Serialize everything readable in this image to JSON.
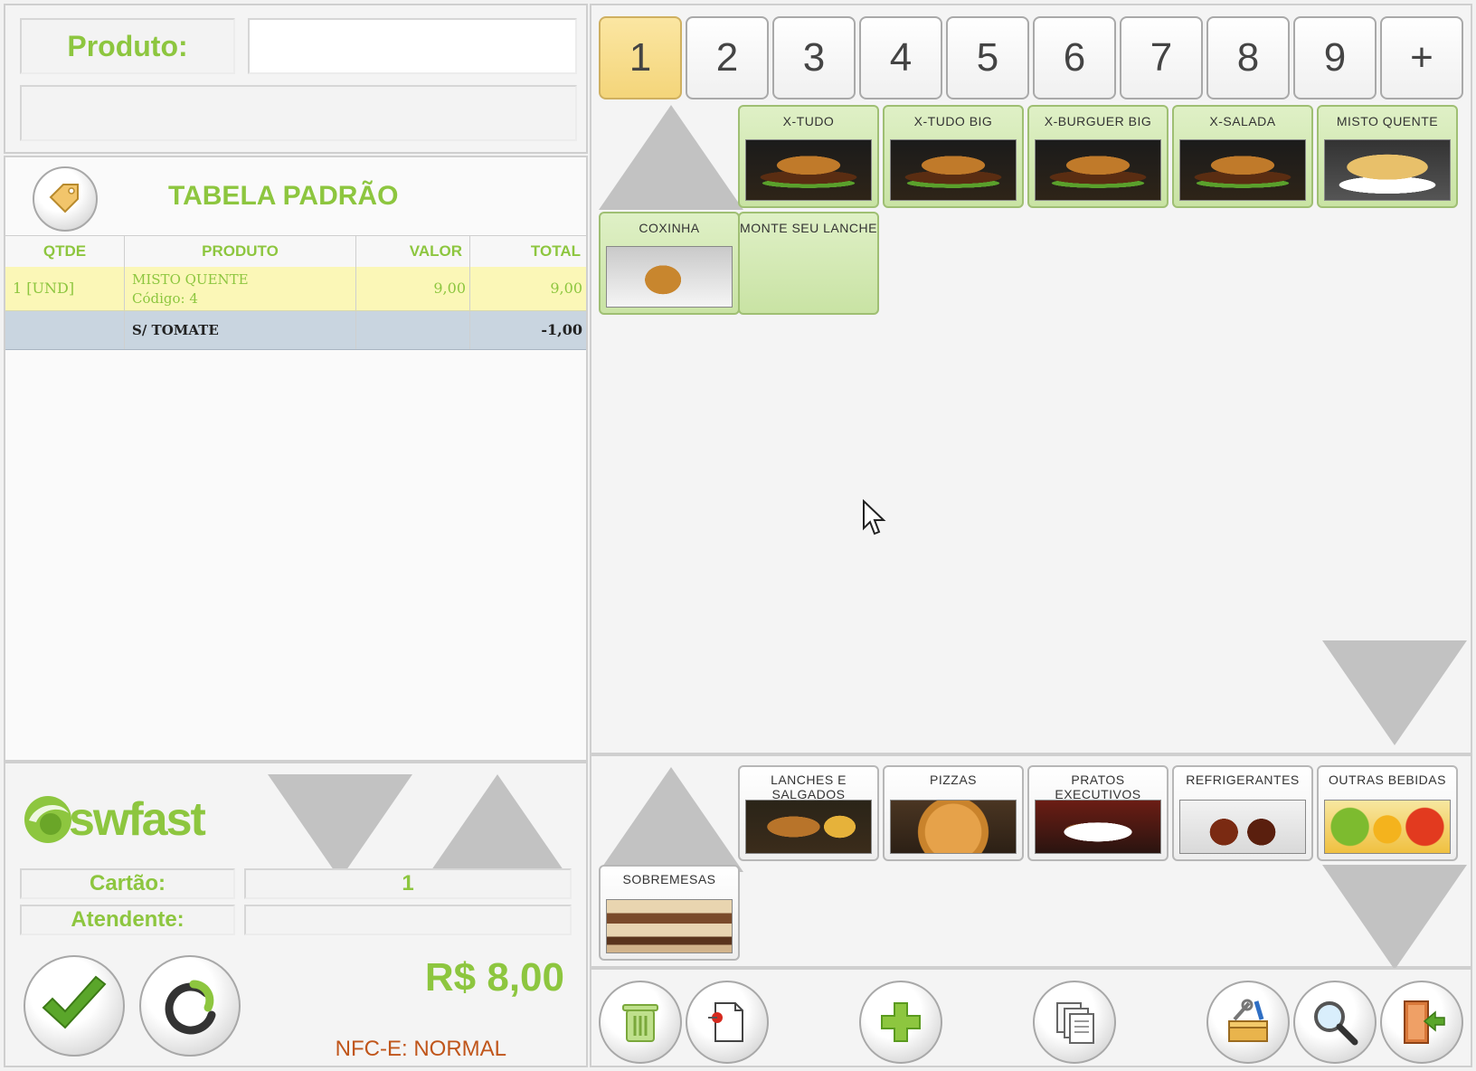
{
  "product_panel": {
    "label": "Produto:",
    "value": "",
    "description": ""
  },
  "price_table": {
    "title": "TABELA PADRÃO"
  },
  "order_table": {
    "headers": [
      "QTDE",
      "PRODUTO",
      "VALOR",
      "TOTAL"
    ],
    "rows": [
      {
        "qty": "1 [UND]",
        "product": "MISTO QUENTE",
        "code": "Código: 4",
        "value": "9,00",
        "total": "9,00"
      },
      {
        "qty": "",
        "product": "S/ TOMATE",
        "code": "",
        "value": "",
        "total": "-1,00"
      }
    ]
  },
  "footer": {
    "brand": "swfast",
    "cartao_label": "Cartão:",
    "cartao_value": "1",
    "atendente_label": "Atendente:",
    "atendente_value": "",
    "total": "R$ 8,00",
    "nfce_status": "NFC-E: NORMAL"
  },
  "page_tabs": [
    "1",
    "2",
    "3",
    "4",
    "5",
    "6",
    "7",
    "8",
    "9",
    "+"
  ],
  "products": [
    {
      "name": "X-TUDO",
      "img": "burger"
    },
    {
      "name": "X-TUDO BIG",
      "img": "burger"
    },
    {
      "name": "X-BURGUER BIG",
      "img": "burger"
    },
    {
      "name": "X-SALADA",
      "img": "burger"
    },
    {
      "name": "MISTO QUENTE",
      "img": "misto"
    },
    {
      "name": "COXINHA",
      "img": "coxinha"
    },
    {
      "name": "MONTE SEU LANCHE",
      "img": ""
    }
  ],
  "categories": [
    {
      "name": "LANCHES E SALGADOS",
      "img": "lanches"
    },
    {
      "name": "PIZZAS",
      "img": "pizza"
    },
    {
      "name": "PRATOS EXECUTIVOS",
      "img": "pratos"
    },
    {
      "name": "REFRIGERANTES",
      "img": "refri"
    },
    {
      "name": "OUTRAS BEBIDAS",
      "img": "bebidas"
    },
    {
      "name": "SOBREMESAS",
      "img": "sobremesa"
    }
  ],
  "colors": {
    "accent_green": "#8dc63f",
    "nfce_orange": "#c0561b",
    "selected_row": "#fbf7b7",
    "addon_row": "#c9d5e0"
  }
}
